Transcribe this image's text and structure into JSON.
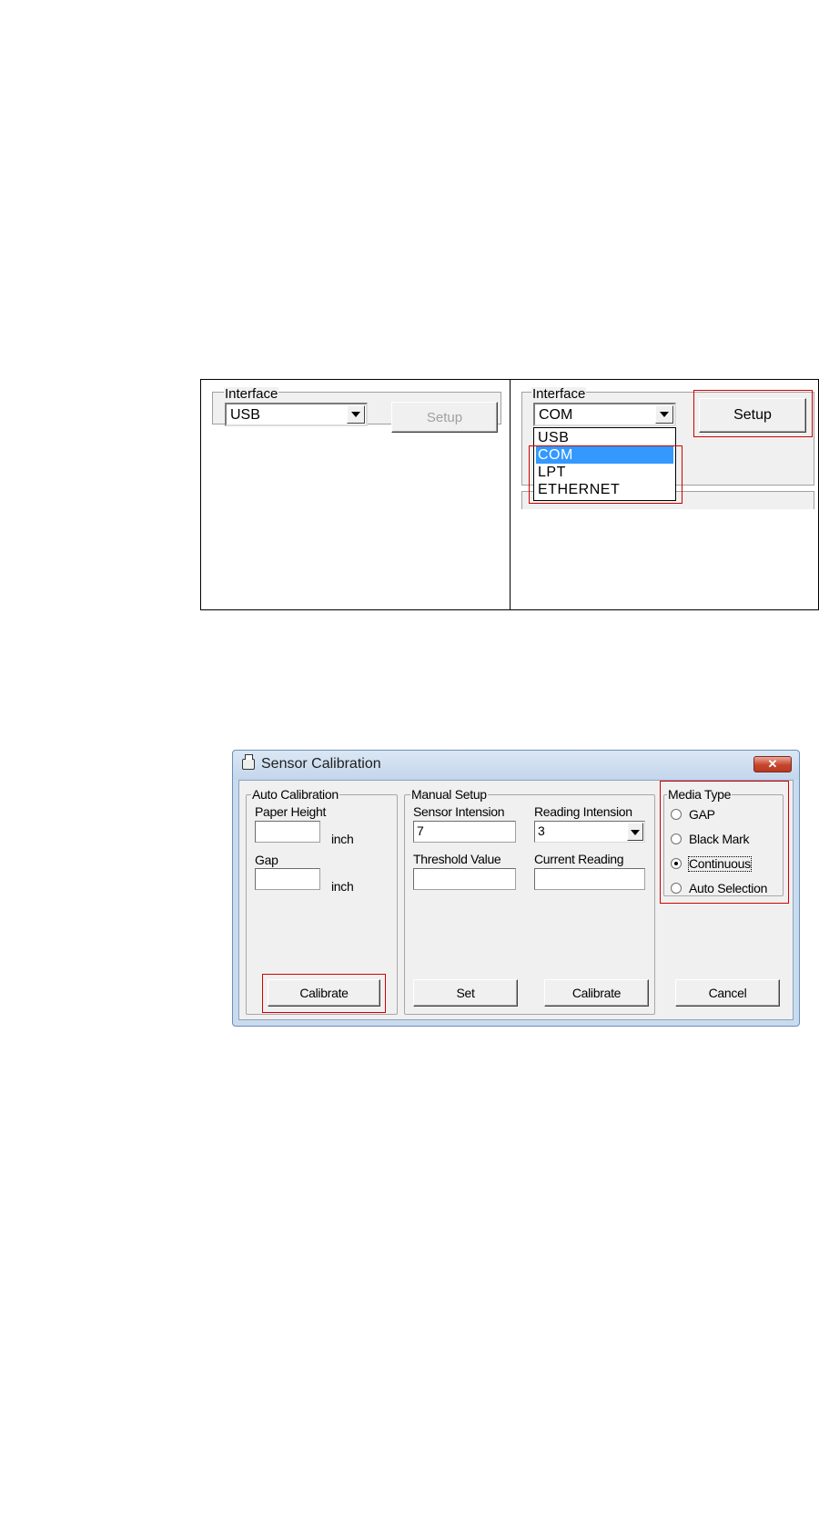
{
  "interface_left": {
    "group_label": "Interface",
    "combo_value": "USB",
    "setup_button": "Setup"
  },
  "interface_right": {
    "group_label": "Interface",
    "combo_value": "COM",
    "setup_button": "Setup",
    "dropdown_options": [
      "USB",
      "COM",
      "LPT",
      "ETHERNET"
    ],
    "selected_option": "COM"
  },
  "dialog": {
    "title": "Sensor Calibration",
    "close_glyph": "✕",
    "auto_calibration": {
      "group_label": "Auto Calibration",
      "paper_height_label": "Paper Height",
      "paper_height_value": "",
      "paper_height_unit": "inch",
      "gap_label": "Gap",
      "gap_value": "",
      "gap_unit": "inch",
      "calibrate_button": "Calibrate"
    },
    "manual_setup": {
      "group_label": "Manual Setup",
      "sensor_intension_label": "Sensor Intension",
      "sensor_intension_value": "7",
      "reading_intension_label": "Reading Intension",
      "reading_intension_value": "3",
      "threshold_value_label": "Threshold Value",
      "threshold_value": "",
      "current_reading_label": "Current Reading",
      "current_reading_value": "",
      "set_button": "Set",
      "calibrate_button": "Calibrate"
    },
    "media_type": {
      "group_label": "Media Type",
      "options": [
        "GAP",
        "Black Mark",
        "Continuous",
        "Auto Selection"
      ],
      "selected": "Continuous"
    },
    "cancel_button": "Cancel"
  },
  "colors": {
    "highlight_red": "#d00000",
    "selection_blue": "#3399ff",
    "dialog_face": "#f0f0f0",
    "title_bar": "#c9dbef",
    "close_red": "#c8452d"
  },
  "icons": {
    "combo_arrow": "triangle-down",
    "close": "x-mark",
    "title": "printer"
  }
}
